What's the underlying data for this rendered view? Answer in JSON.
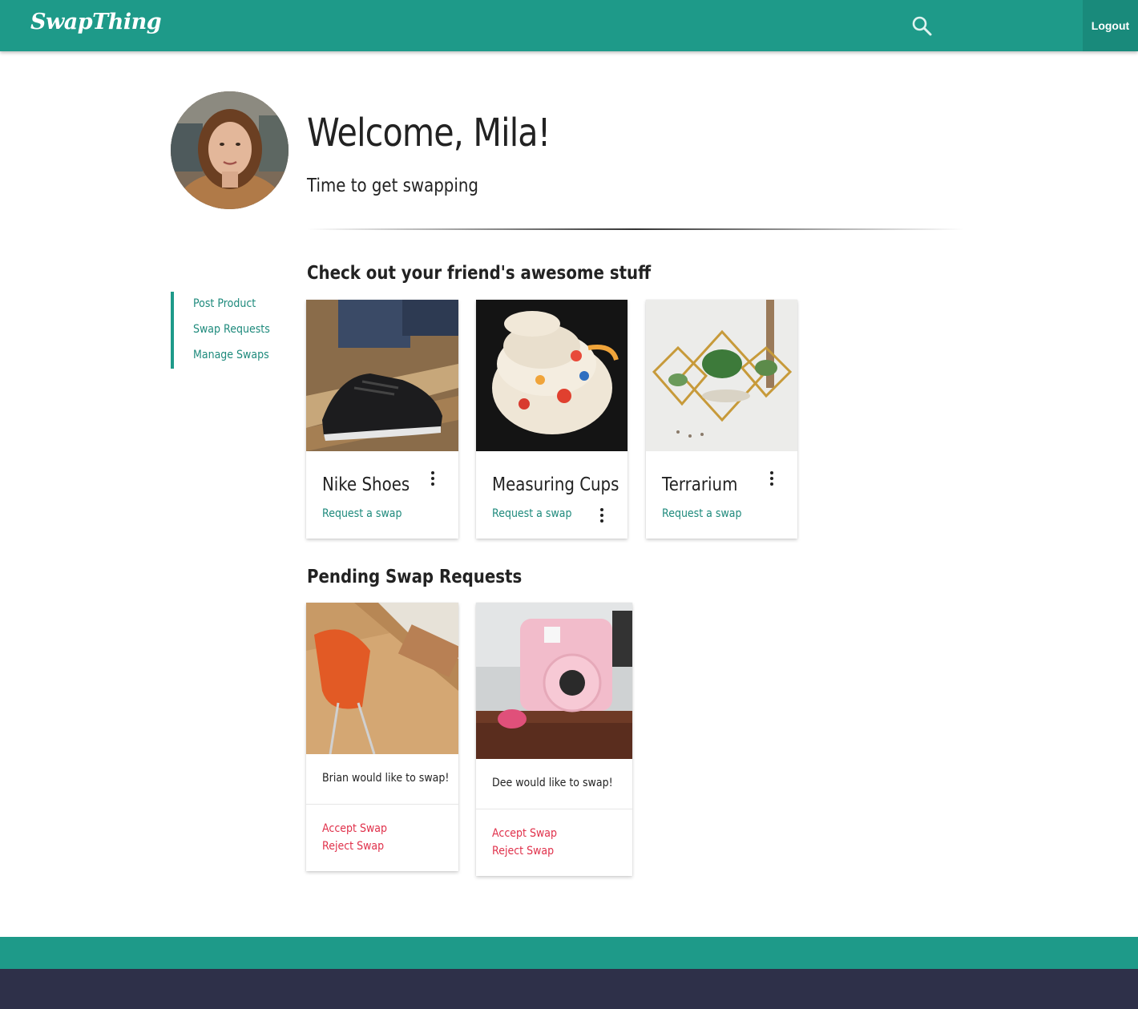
{
  "nav": {
    "brand": "SwapThing",
    "search_icon": "search-icon",
    "logout_label": "Logout"
  },
  "profile": {
    "welcome": "Welcome, Mila!",
    "subtitle": "Time to get swapping"
  },
  "sidebar": {
    "items": [
      {
        "label": "Post Product"
      },
      {
        "label": "Swap Requests"
      },
      {
        "label": "Manage Swaps"
      }
    ]
  },
  "friends": {
    "title": "Check out your friend's awesome stuff",
    "products": [
      {
        "name": "Nike Shoes",
        "action": "Request a swap"
      },
      {
        "name": "Measuring Cups",
        "action": "Request a swap"
      },
      {
        "name": "Terrarium",
        "action": "Request a swap"
      }
    ]
  },
  "pending": {
    "title": "Pending Swap Requests",
    "requests": [
      {
        "message": "Brian would like to swap!",
        "accept": "Accept Swap",
        "reject": "Reject Swap"
      },
      {
        "message": "Dee would like to swap!",
        "accept": "Accept Swap",
        "reject": "Reject Swap"
      }
    ]
  },
  "colors": {
    "primary": "#1e9a89",
    "link": "#1e8a7c",
    "danger": "#e0314b",
    "footer_dark": "#2e3049"
  }
}
